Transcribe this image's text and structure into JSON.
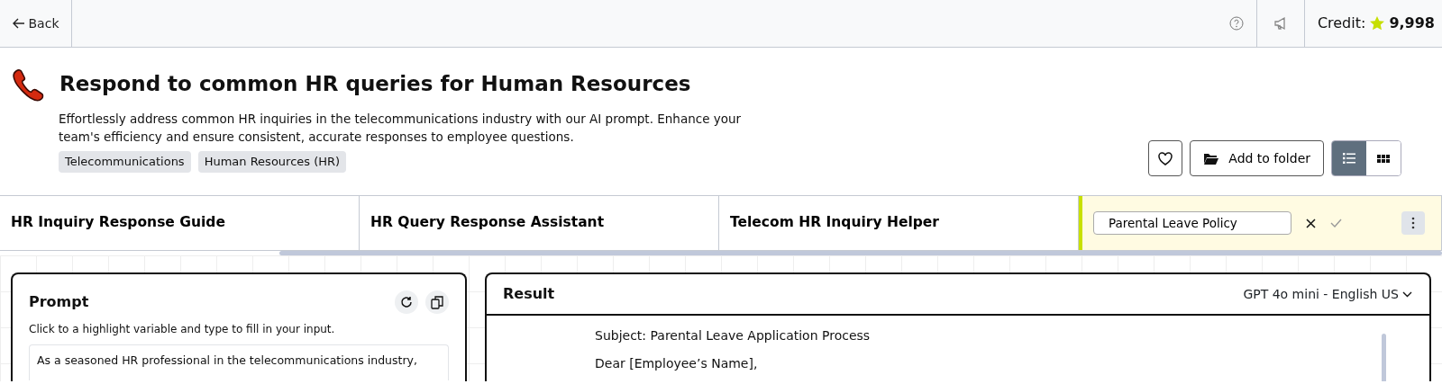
{
  "topbar": {
    "back": "Back",
    "credit_label": "Credit:",
    "credit_value": "9,998"
  },
  "header": {
    "title": "Respond to common HR queries for Human Resources",
    "description": "Effortlessly address common HR inquiries in the telecommunications industry with our AI prompt. Enhance your team's efficiency and ensure consistent, accurate responses to employee questions.",
    "tags": [
      "Telecommunications",
      "Human Resources (HR)"
    ]
  },
  "actions": {
    "favorite": false,
    "add_to_folder": "Add to folder",
    "view": [
      {
        "kind": "list",
        "selected": true
      },
      {
        "kind": "grid",
        "selected": false
      }
    ]
  },
  "tabs": [
    {
      "kind": "tab",
      "label": "HR Inquiry Response Guide"
    },
    {
      "kind": "tab",
      "label": "HR Query Response Assistant"
    },
    {
      "kind": "tab",
      "label": "Telecom HR Inquiry Helper"
    },
    {
      "kind": "edit",
      "value": "Parental Leave Policy"
    }
  ],
  "prompt": {
    "title": "Prompt",
    "hint": "Click to a highlight variable and type to fill in your input.",
    "text": "As a seasoned HR professional in the telecommunications industry,"
  },
  "result": {
    "title": "Result",
    "model": "GPT 4o mini - English US",
    "lines": [
      "Subject: Parental Leave Application Process",
      "Dear [Employee’s Name],"
    ]
  }
}
